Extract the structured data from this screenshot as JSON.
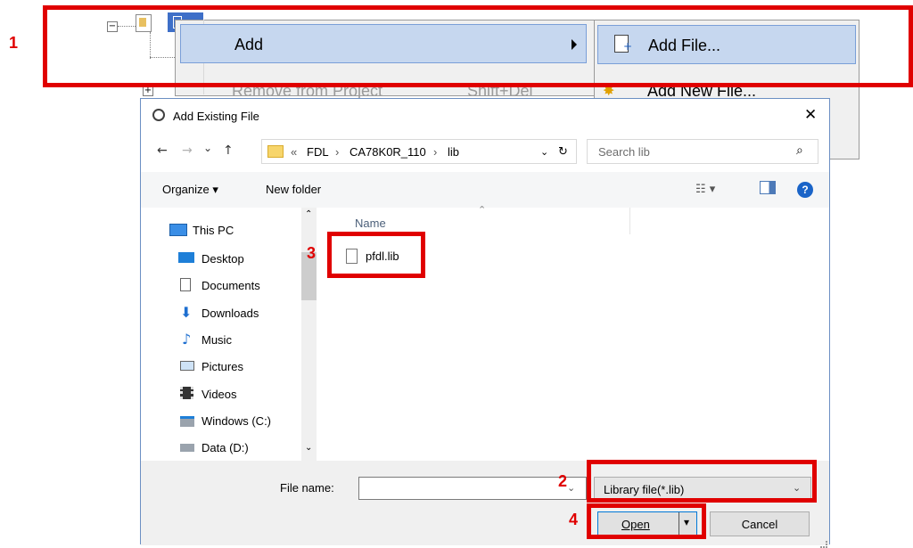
{
  "context_menu": {
    "add_label": "Add",
    "remove_label": "Remove from Project",
    "remove_shortcut": "Shift+Del"
  },
  "submenu": {
    "add_file_label": "Add File...",
    "add_new_file_label": "Add New File..."
  },
  "annotations": {
    "step1": "1",
    "step2": "2",
    "step3": "3",
    "step4": "4",
    "color": "#e00000"
  },
  "dialog": {
    "title": "Add Existing File",
    "close_glyph": "✕",
    "nav_back": "←",
    "nav_forward": "→",
    "nav_recent": "⌄",
    "nav_up": "↑",
    "path_prefix": "«",
    "breadcrumbs": [
      "FDL",
      "CA78K0R_110",
      "lib"
    ],
    "breadcrumb_sep": "›",
    "refresh_glyph": "↻",
    "search_placeholder": "Search lib",
    "toolbar": {
      "organize": "Organize ▾",
      "new_folder": "New folder"
    },
    "nav_pane": {
      "this_pc": "This PC",
      "items": [
        "Desktop",
        "Documents",
        "Downloads",
        "Music",
        "Pictures",
        "Videos",
        "Windows (C:)",
        "Data (D:)"
      ]
    },
    "columns": {
      "name": "Name"
    },
    "files": [
      "pfdl.lib"
    ],
    "file_name_label": "File name:",
    "file_name_value": "",
    "file_type": "Library file(*.lib)",
    "open_label": "Open",
    "cancel_label": "Cancel"
  }
}
